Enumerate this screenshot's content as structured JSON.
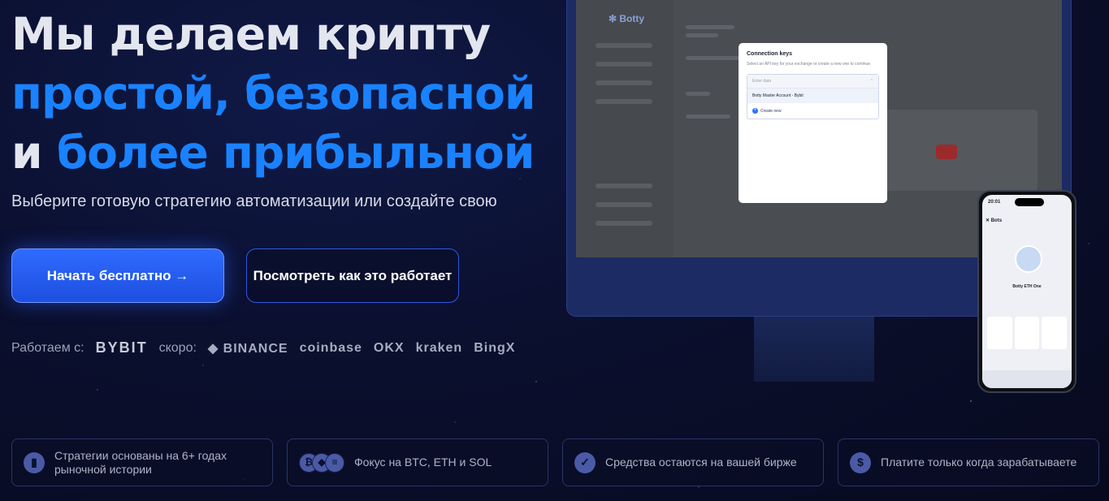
{
  "hero": {
    "title_line1": "Мы делаем крипту",
    "title_line2": "простой, безопасной",
    "title_line3_prefix": "и",
    "title_line3_highlight": "более прибыльной",
    "subtitle": "Выберите готовую стратегию автоматизации или создайте свою"
  },
  "buttons": {
    "primary_label": "Начать бесплатно →",
    "secondary_label": "Посмотреть как это работает"
  },
  "partners": {
    "label": "Работаем с:",
    "current": "BYBIT",
    "soon_label": "скоро:",
    "soon": [
      "BINANCE",
      "coinbase",
      "OKX",
      "kraken",
      "BingX"
    ]
  },
  "features": [
    {
      "icon": "clipboard-icon",
      "text": "Стратегии основаны на 6+ годах рыночной истории"
    },
    {
      "icon": "coins-icon",
      "text": "Фокус на BTC, ETH и SOL"
    },
    {
      "icon": "shield-icon",
      "text": "Средства остаются на вашей бирже"
    },
    {
      "icon": "dollar-icon",
      "text": "Платите только когда зарабатываете"
    }
  ],
  "app_preview": {
    "brand": "Botty",
    "modal": {
      "title": "Connection keys",
      "description": "Select an API key for your exchange or create a new one to continue.",
      "dropdown_placeholder": "Enter data",
      "option": "Botty Master Account - Bybit",
      "create_new": "Create new"
    },
    "phone": {
      "time": "20:01",
      "header": "Bots",
      "bot_name": "Botty ETH One"
    }
  },
  "colors": {
    "accent": "#1a82ff",
    "primary_button": "#2f6bff",
    "background": "#0b1030"
  }
}
